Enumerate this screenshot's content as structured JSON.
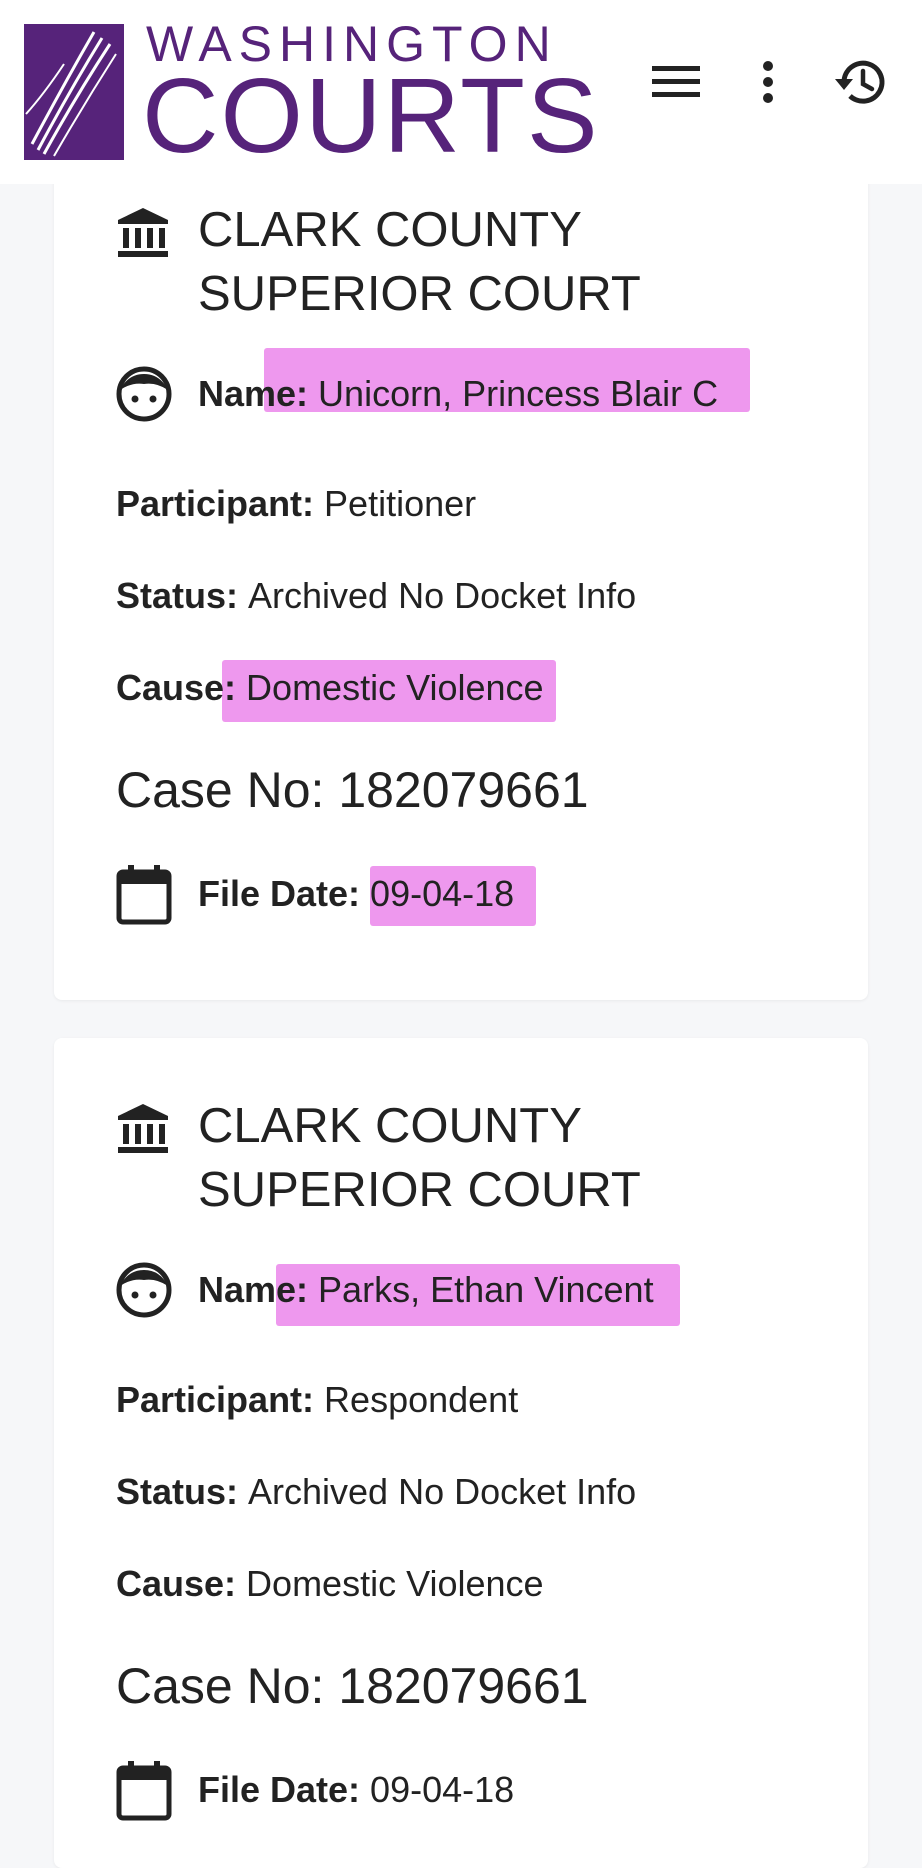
{
  "header": {
    "logo_line1": "WASHINGTON",
    "logo_line2": "COURTS",
    "brand_color": "#56237a",
    "icons": [
      "menu-icon",
      "more-vert-icon",
      "history-icon"
    ]
  },
  "highlight_color": "#ee88ee",
  "cases": [
    {
      "court": "CLARK COUNTY\nSUPERIOR COURT",
      "name_label": "Name:",
      "name_value": "Unicorn, Princess Blair C",
      "participant_label": "Participant:",
      "participant_value": "Petitioner",
      "status_label": "Status:",
      "status_value": "Archived No Docket Info",
      "cause_label": "Cause:",
      "cause_value": "Domestic Violence",
      "case_no": "Case No: 182079661",
      "file_date_label": "File Date:",
      "file_date_value": "09-04-18"
    },
    {
      "court": "CLARK COUNTY\nSUPERIOR COURT",
      "name_label": "Name:",
      "name_value": "Parks, Ethan Vincent",
      "participant_label": "Participant:",
      "participant_value": "Respondent",
      "status_label": "Status:",
      "status_value": "Archived No Docket Info",
      "cause_label": "Cause:",
      "cause_value": "Domestic Violence",
      "case_no": "Case No: 182079661",
      "file_date_label": "File Date:",
      "file_date_value": "09-04-18"
    }
  ]
}
